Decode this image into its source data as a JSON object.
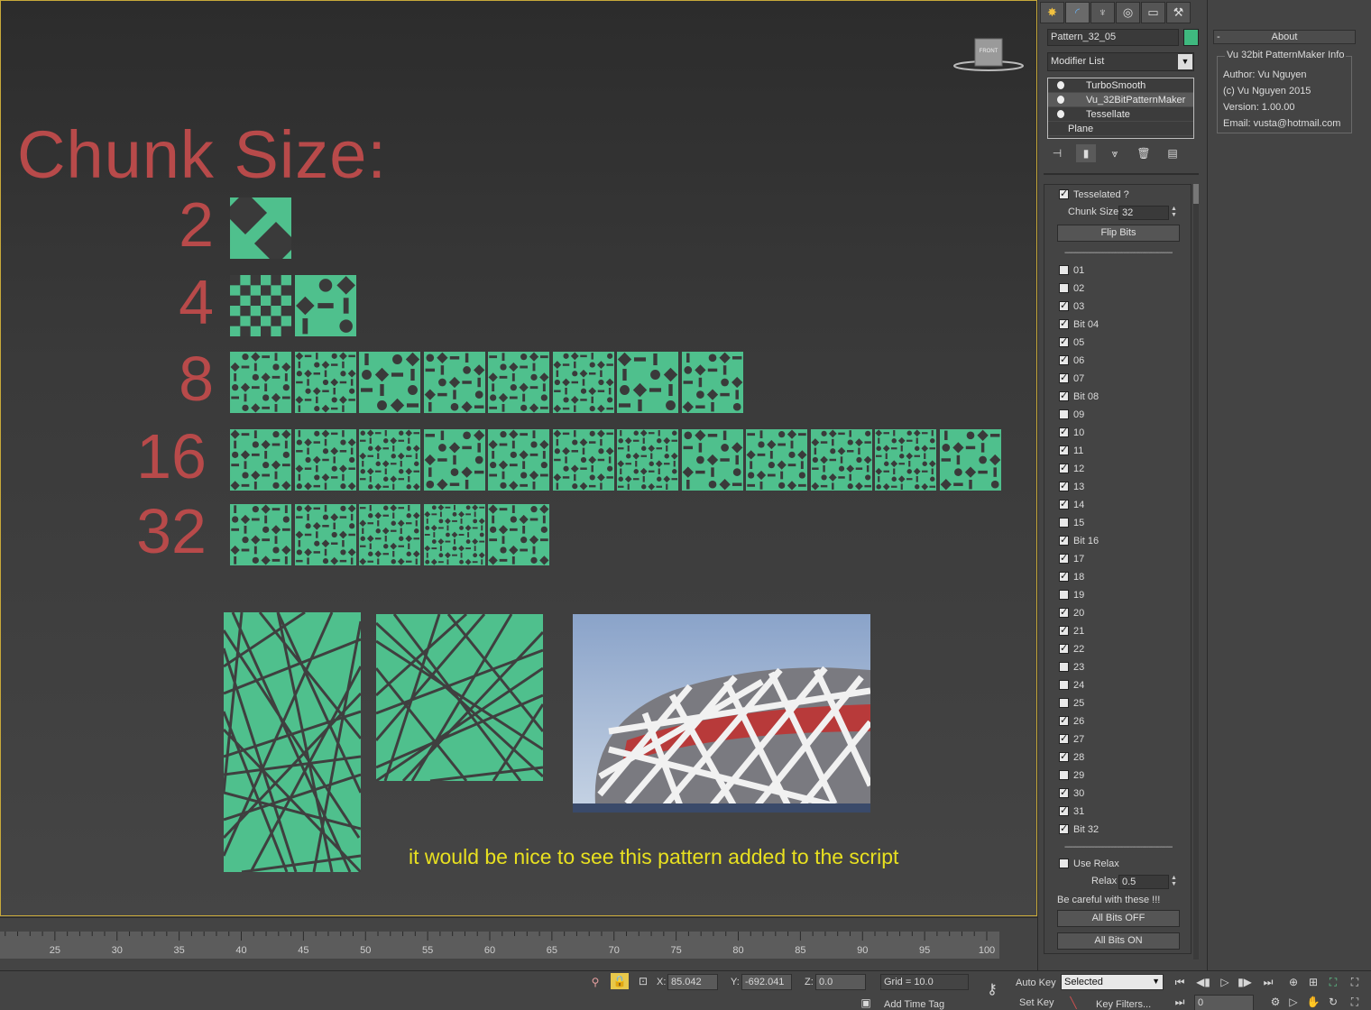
{
  "viewport": {
    "title": "Chunk Size:",
    "viewcube_label": "FRONT",
    "rows": [
      {
        "label": "2",
        "count": 1
      },
      {
        "label": "4",
        "count": 2
      },
      {
        "label": "8",
        "count": 8
      },
      {
        "label": "16",
        "count": 12
      },
      {
        "label": "32",
        "count": 5
      }
    ],
    "caption": "it would be nice to see this pattern added to the script",
    "pattern_color": "#4fc08d",
    "label_color": "#b84a4a",
    "caption_color": "#e8e020"
  },
  "timeline": {
    "ticks": [
      "25",
      "30",
      "35",
      "40",
      "45",
      "50",
      "55",
      "60",
      "65",
      "70",
      "75",
      "80",
      "85",
      "90",
      "95",
      "100"
    ]
  },
  "statusbar": {
    "x_label": "X:",
    "x_value": "85.042",
    "y_label": "Y:",
    "y_value": "-692.041",
    "z_label": "Z:",
    "z_value": "0.0",
    "grid": "Grid = 10.0",
    "add_time_tag": "Add Time Tag",
    "auto_key": "Auto Key",
    "set_key": "Set Key",
    "selected": "Selected",
    "key_filters": "Key Filters...",
    "frame": "0"
  },
  "command_panel": {
    "tabs": [
      "create-icon",
      "modify-icon",
      "hierarchy-icon",
      "motion-icon",
      "display-icon",
      "utilities-icon"
    ],
    "object_name": "Pattern_32_05",
    "object_color": "#3fb97f",
    "modifier_list": "Modifier List",
    "stack": [
      "TurboSmooth",
      "Vu_32BitPatternMaker",
      "Tessellate",
      "Plane"
    ],
    "tesselated_label": "Tesselated ?",
    "chunk_size_label": "Chunk Size",
    "chunk_size_value": "32",
    "flip_bits": "Flip Bits",
    "bits": [
      {
        "label": "01",
        "on": false
      },
      {
        "label": "02",
        "on": false
      },
      {
        "label": "03",
        "on": true
      },
      {
        "label": "Bit 04",
        "on": true
      },
      {
        "label": "05",
        "on": true
      },
      {
        "label": "06",
        "on": true
      },
      {
        "label": "07",
        "on": true
      },
      {
        "label": "Bit 08",
        "on": true
      },
      {
        "label": "09",
        "on": false
      },
      {
        "label": "10",
        "on": true
      },
      {
        "label": "11",
        "on": true
      },
      {
        "label": "12",
        "on": true
      },
      {
        "label": "13",
        "on": true
      },
      {
        "label": "14",
        "on": true
      },
      {
        "label": "15",
        "on": false
      },
      {
        "label": "Bit 16",
        "on": true
      },
      {
        "label": "17",
        "on": true
      },
      {
        "label": "18",
        "on": true
      },
      {
        "label": "19",
        "on": false
      },
      {
        "label": "20",
        "on": true
      },
      {
        "label": "21",
        "on": true
      },
      {
        "label": "22",
        "on": true
      },
      {
        "label": "23",
        "on": false
      },
      {
        "label": "24",
        "on": false
      },
      {
        "label": "25",
        "on": false
      },
      {
        "label": "26",
        "on": true
      },
      {
        "label": "27",
        "on": true
      },
      {
        "label": "28",
        "on": true
      },
      {
        "label": "29",
        "on": false
      },
      {
        "label": "30",
        "on": true
      },
      {
        "label": "31",
        "on": true
      },
      {
        "label": "Bit 32",
        "on": true
      }
    ],
    "use_relax": "Use Relax",
    "relax_label": "Relax",
    "relax_value": "0.5",
    "careful": "Be careful with these !!!",
    "all_off": "All Bits OFF",
    "all_on": "All Bits ON"
  },
  "about": {
    "header": "About",
    "minus": "-",
    "group_title": "Vu 32bit PatternMaker Info",
    "author": "Author: Vu Nguyen",
    "copyright": "(c) Vu Nguyen 2015",
    "version": "Version: 1.00.00",
    "email": "Email: vusta@hotmail.com"
  }
}
